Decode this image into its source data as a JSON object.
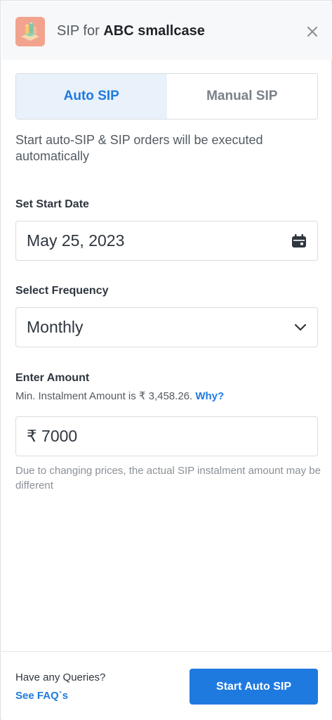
{
  "header": {
    "title_prefix": "SIP for ",
    "title_name": "ABC smallcase",
    "logo_icon": "smallcase-logo-icon",
    "close_icon": "close-icon"
  },
  "tabs": [
    {
      "label": "Auto SIP",
      "active": true
    },
    {
      "label": "Manual SIP",
      "active": false
    }
  ],
  "description": "Start auto-SIP & SIP orders will be executed automatically",
  "start_date": {
    "label": "Set Start Date",
    "value": "May 25, 2023",
    "icon": "calendar-icon"
  },
  "frequency": {
    "label": "Select Frequency",
    "value": "Monthly",
    "icon": "chevron-down-icon"
  },
  "amount": {
    "label": "Enter Amount",
    "hint": "Min. Instalment Amount is ₹ 3,458.26. ",
    "why": "Why?",
    "value": "₹ 7000",
    "note": "Due to changing prices, the actual SIP instalment amount may be different"
  },
  "footer": {
    "queries": "Have any Queries?",
    "faq": "See FAQ`s",
    "cta": "Start Auto SIP"
  },
  "colors": {
    "accent": "#1f7ae0",
    "active_tab_bg": "#e9f1fb",
    "logo_bg": "#f2a38e"
  }
}
